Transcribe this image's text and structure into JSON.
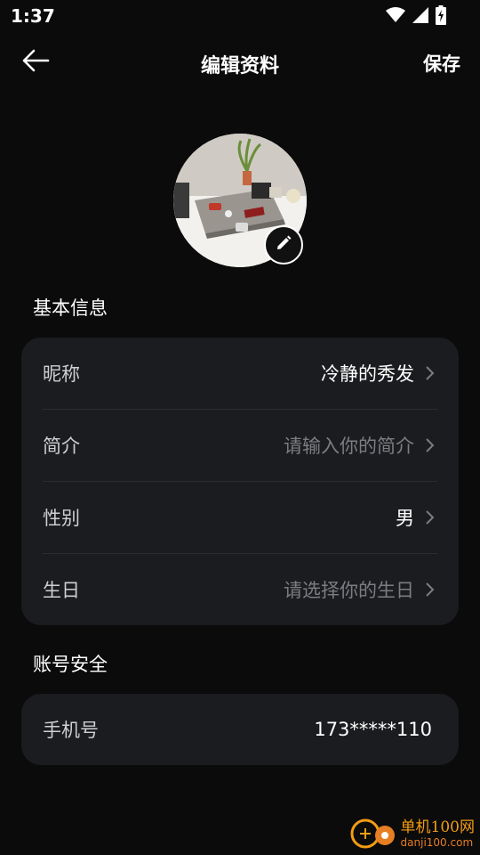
{
  "status_bar": {
    "time": "1:37",
    "icons": [
      "wifi-icon",
      "cell-signal-icon",
      "battery-charging-icon"
    ]
  },
  "header": {
    "title": "编辑资料",
    "save_label": "保存",
    "back_icon": "arrow-left-icon"
  },
  "avatar": {
    "edit_icon": "pencil-icon"
  },
  "basic_info": {
    "title": "基本信息",
    "rows": [
      {
        "label": "昵称",
        "value": "冷静的秀发",
        "placeholder": false
      },
      {
        "label": "简介",
        "value": "请输入你的简介",
        "placeholder": true
      },
      {
        "label": "性别",
        "value": "男",
        "placeholder": false
      },
      {
        "label": "生日",
        "value": "请选择你的生日",
        "placeholder": true
      }
    ]
  },
  "account_security": {
    "title": "账号安全",
    "rows": [
      {
        "label": "手机号",
        "value": "173*****110"
      }
    ]
  },
  "watermark": {
    "title": "单机100网",
    "url": "danji100.com"
  },
  "colors": {
    "background": "#0b0b0c",
    "card": "#1b1c1f",
    "placeholder": "#7c7d82",
    "watermark": "#f39c12"
  }
}
